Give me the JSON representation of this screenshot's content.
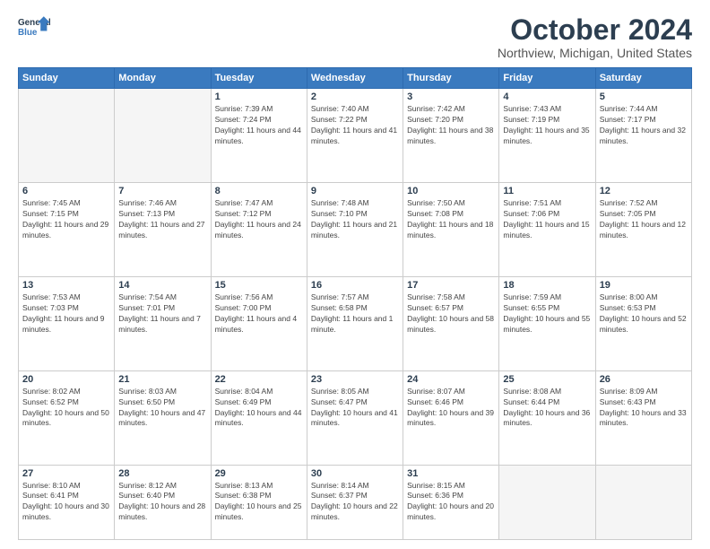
{
  "header": {
    "logo_line1": "General",
    "logo_line2": "Blue",
    "month": "October 2024",
    "location": "Northview, Michigan, United States"
  },
  "weekdays": [
    "Sunday",
    "Monday",
    "Tuesday",
    "Wednesday",
    "Thursday",
    "Friday",
    "Saturday"
  ],
  "weeks": [
    [
      {
        "day": "",
        "empty": true
      },
      {
        "day": "",
        "empty": true
      },
      {
        "day": "1",
        "sunrise": "7:39 AM",
        "sunset": "7:24 PM",
        "daylight": "11 hours and 44 minutes."
      },
      {
        "day": "2",
        "sunrise": "7:40 AM",
        "sunset": "7:22 PM",
        "daylight": "11 hours and 41 minutes."
      },
      {
        "day": "3",
        "sunrise": "7:42 AM",
        "sunset": "7:20 PM",
        "daylight": "11 hours and 38 minutes."
      },
      {
        "day": "4",
        "sunrise": "7:43 AM",
        "sunset": "7:19 PM",
        "daylight": "11 hours and 35 minutes."
      },
      {
        "day": "5",
        "sunrise": "7:44 AM",
        "sunset": "7:17 PM",
        "daylight": "11 hours and 32 minutes."
      }
    ],
    [
      {
        "day": "6",
        "sunrise": "7:45 AM",
        "sunset": "7:15 PM",
        "daylight": "11 hours and 29 minutes."
      },
      {
        "day": "7",
        "sunrise": "7:46 AM",
        "sunset": "7:13 PM",
        "daylight": "11 hours and 27 minutes."
      },
      {
        "day": "8",
        "sunrise": "7:47 AM",
        "sunset": "7:12 PM",
        "daylight": "11 hours and 24 minutes."
      },
      {
        "day": "9",
        "sunrise": "7:48 AM",
        "sunset": "7:10 PM",
        "daylight": "11 hours and 21 minutes."
      },
      {
        "day": "10",
        "sunrise": "7:50 AM",
        "sunset": "7:08 PM",
        "daylight": "11 hours and 18 minutes."
      },
      {
        "day": "11",
        "sunrise": "7:51 AM",
        "sunset": "7:06 PM",
        "daylight": "11 hours and 15 minutes."
      },
      {
        "day": "12",
        "sunrise": "7:52 AM",
        "sunset": "7:05 PM",
        "daylight": "11 hours and 12 minutes."
      }
    ],
    [
      {
        "day": "13",
        "sunrise": "7:53 AM",
        "sunset": "7:03 PM",
        "daylight": "11 hours and 9 minutes."
      },
      {
        "day": "14",
        "sunrise": "7:54 AM",
        "sunset": "7:01 PM",
        "daylight": "11 hours and 7 minutes."
      },
      {
        "day": "15",
        "sunrise": "7:56 AM",
        "sunset": "7:00 PM",
        "daylight": "11 hours and 4 minutes."
      },
      {
        "day": "16",
        "sunrise": "7:57 AM",
        "sunset": "6:58 PM",
        "daylight": "11 hours and 1 minute."
      },
      {
        "day": "17",
        "sunrise": "7:58 AM",
        "sunset": "6:57 PM",
        "daylight": "10 hours and 58 minutes."
      },
      {
        "day": "18",
        "sunrise": "7:59 AM",
        "sunset": "6:55 PM",
        "daylight": "10 hours and 55 minutes."
      },
      {
        "day": "19",
        "sunrise": "8:00 AM",
        "sunset": "6:53 PM",
        "daylight": "10 hours and 52 minutes."
      }
    ],
    [
      {
        "day": "20",
        "sunrise": "8:02 AM",
        "sunset": "6:52 PM",
        "daylight": "10 hours and 50 minutes."
      },
      {
        "day": "21",
        "sunrise": "8:03 AM",
        "sunset": "6:50 PM",
        "daylight": "10 hours and 47 minutes."
      },
      {
        "day": "22",
        "sunrise": "8:04 AM",
        "sunset": "6:49 PM",
        "daylight": "10 hours and 44 minutes."
      },
      {
        "day": "23",
        "sunrise": "8:05 AM",
        "sunset": "6:47 PM",
        "daylight": "10 hours and 41 minutes."
      },
      {
        "day": "24",
        "sunrise": "8:07 AM",
        "sunset": "6:46 PM",
        "daylight": "10 hours and 39 minutes."
      },
      {
        "day": "25",
        "sunrise": "8:08 AM",
        "sunset": "6:44 PM",
        "daylight": "10 hours and 36 minutes."
      },
      {
        "day": "26",
        "sunrise": "8:09 AM",
        "sunset": "6:43 PM",
        "daylight": "10 hours and 33 minutes."
      }
    ],
    [
      {
        "day": "27",
        "sunrise": "8:10 AM",
        "sunset": "6:41 PM",
        "daylight": "10 hours and 30 minutes."
      },
      {
        "day": "28",
        "sunrise": "8:12 AM",
        "sunset": "6:40 PM",
        "daylight": "10 hours and 28 minutes."
      },
      {
        "day": "29",
        "sunrise": "8:13 AM",
        "sunset": "6:38 PM",
        "daylight": "10 hours and 25 minutes."
      },
      {
        "day": "30",
        "sunrise": "8:14 AM",
        "sunset": "6:37 PM",
        "daylight": "10 hours and 22 minutes."
      },
      {
        "day": "31",
        "sunrise": "8:15 AM",
        "sunset": "6:36 PM",
        "daylight": "10 hours and 20 minutes."
      },
      {
        "day": "",
        "empty": true
      },
      {
        "day": "",
        "empty": true
      }
    ]
  ]
}
